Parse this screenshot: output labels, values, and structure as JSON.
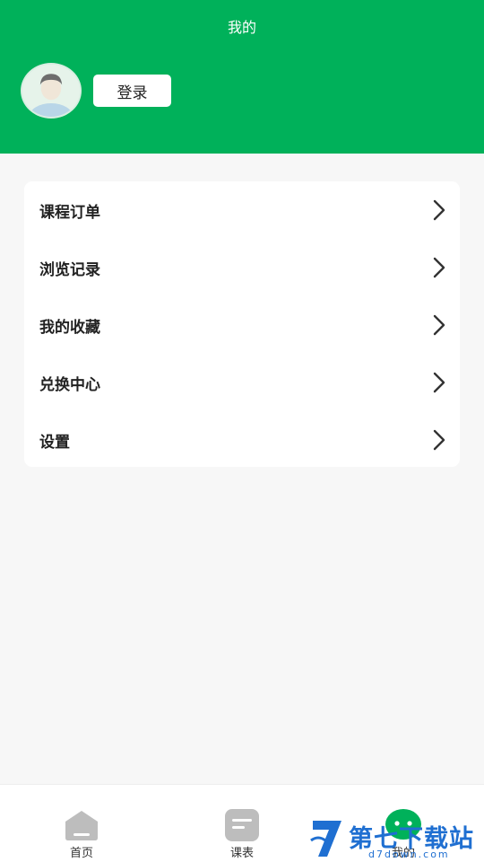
{
  "header": {
    "title": "我的",
    "login_label": "登录"
  },
  "menu": {
    "items": [
      {
        "label": "课程订单"
      },
      {
        "label": "浏览记录"
      },
      {
        "label": "我的收藏"
      },
      {
        "label": "兑换中心"
      },
      {
        "label": "设置"
      }
    ]
  },
  "tabbar": {
    "tabs": [
      {
        "label": "首页",
        "icon": "home-icon"
      },
      {
        "label": "课表",
        "icon": "schedule-icon"
      },
      {
        "label": "我的",
        "icon": "profile-icon"
      }
    ]
  },
  "watermark": {
    "text": "第七下载站",
    "sub": "d7down.com"
  },
  "colors": {
    "brand_green": "#00b15a",
    "background": "#f7f7f7",
    "icon_gray": "#bdbdbd",
    "watermark_blue": "#1f6fd1"
  }
}
